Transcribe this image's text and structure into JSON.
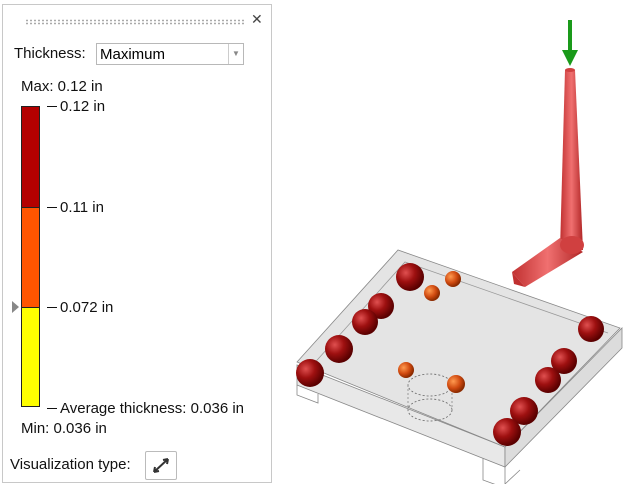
{
  "panel": {
    "thickness_label": "Thickness:",
    "thickness_value": "Maximum",
    "max_label": "Max: 0.12 in",
    "min_label": "Min:  0.036 in",
    "legend": {
      "levels": [
        "0.12 in",
        "0.11 in",
        "0.072 in",
        "Average thickness: 0.036 in"
      ],
      "colors": [
        "#b30000",
        "#ff5500",
        "#ffff00"
      ]
    },
    "visualization_label": "Visualization type:"
  },
  "icons": [
    "drag-grip-icon",
    "close-icon",
    "chevron-down-icon",
    "slider-pointer-icon",
    "expand-arrows-icon",
    "load-arrow-icon"
  ]
}
